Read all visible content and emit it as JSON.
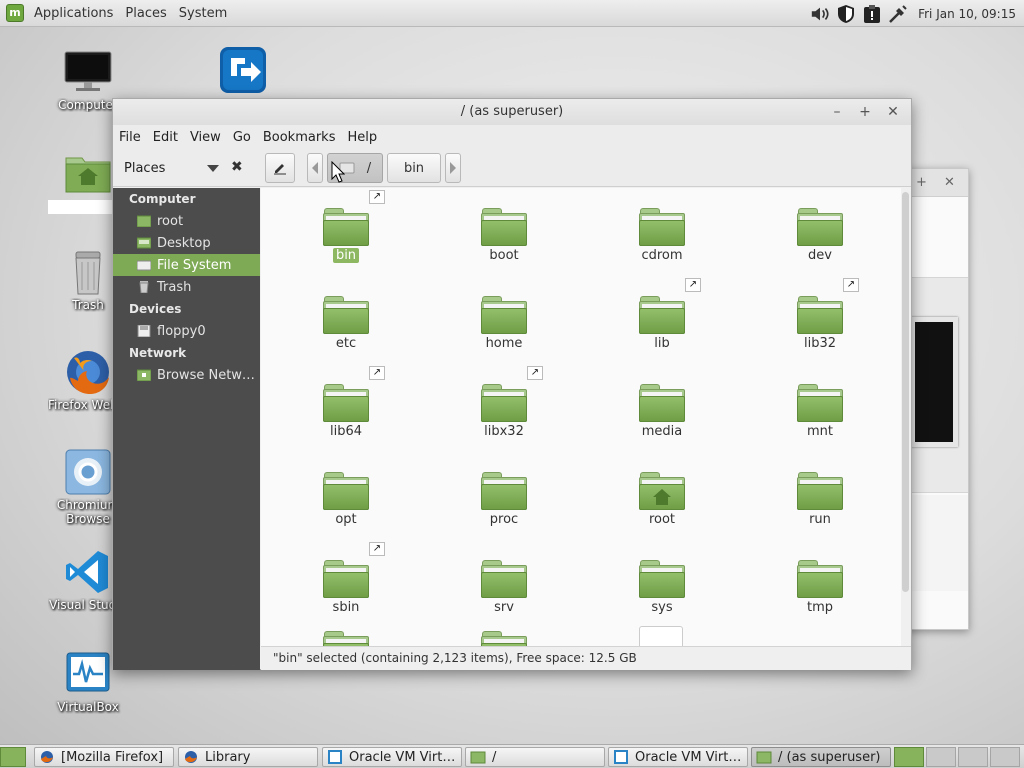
{
  "top_panel": {
    "menus": [
      "Applications",
      "Places",
      "System"
    ],
    "clock": "Fri Jan 10, 09:15",
    "tray_icons": [
      "volume-icon",
      "shield-icon",
      "clipboard-alert-icon",
      "network-icon"
    ]
  },
  "desktop": {
    "icons": [
      {
        "label": "Computer",
        "icon": "monitor-icon"
      },
      {
        "label": "",
        "icon": "blue-arrow-app-icon"
      },
      {
        "label": "",
        "icon": "home-folder-icon"
      },
      {
        "label": "Trash",
        "icon": "trash-icon"
      },
      {
        "label": "Firefox Web B",
        "icon": "firefox-icon"
      },
      {
        "label": "Chromium",
        "label2": "Browse",
        "icon": "chromium-icon"
      },
      {
        "label": "Visual Studio",
        "icon": "vscode-icon"
      },
      {
        "label": "VirtualBox",
        "icon": "virtualbox-icon"
      }
    ]
  },
  "window": {
    "title": "/ (as superuser)",
    "menus": [
      "File",
      "Edit",
      "View",
      "Go",
      "Bookmarks",
      "Help"
    ],
    "places_label": "Places",
    "breadcrumbs": [
      "/",
      "bin"
    ]
  },
  "sidebar": {
    "sections": [
      {
        "heading": "Computer",
        "items": [
          "root",
          "Desktop",
          "File System",
          "Trash"
        ]
      },
      {
        "heading": "Devices",
        "items": [
          "floppy0"
        ]
      },
      {
        "heading": "Network",
        "items": [
          "Browse Netw…"
        ]
      }
    ],
    "selected": "File System"
  },
  "files": [
    {
      "name": "bin",
      "link": true,
      "selected": true
    },
    {
      "name": "boot",
      "link": false
    },
    {
      "name": "cdrom",
      "link": false
    },
    {
      "name": "dev",
      "link": false
    },
    {
      "name": "etc",
      "link": false
    },
    {
      "name": "home",
      "link": false
    },
    {
      "name": "lib",
      "link": true
    },
    {
      "name": "lib32",
      "link": true
    },
    {
      "name": "lib64",
      "link": true
    },
    {
      "name": "libx32",
      "link": true
    },
    {
      "name": "media",
      "link": false
    },
    {
      "name": "mnt",
      "link": false
    },
    {
      "name": "opt",
      "link": false
    },
    {
      "name": "proc",
      "link": false
    },
    {
      "name": "root",
      "link": false,
      "home": true
    },
    {
      "name": "run",
      "link": false
    },
    {
      "name": "sbin",
      "link": true
    },
    {
      "name": "srv",
      "link": false
    },
    {
      "name": "sys",
      "link": false
    },
    {
      "name": "tmp",
      "link": false
    }
  ],
  "status": "\"bin\" selected (containing 2,123 items), Free space: 12.5 GB",
  "taskbar": {
    "items": [
      {
        "label": "[Mozilla Firefox]",
        "icon": "firefox-icon"
      },
      {
        "label": "Library",
        "icon": "firefox-icon"
      },
      {
        "label": "Oracle VM Virt…",
        "icon": "virtualbox-icon"
      },
      {
        "label": "/",
        "icon": "folder-icon"
      },
      {
        "label": "Oracle VM Virt…",
        "icon": "virtualbox-icon"
      },
      {
        "label": "/ (as superuser)",
        "icon": "folder-icon",
        "active": true
      }
    ]
  },
  "colors": {
    "accent": "#7faa55",
    "folder": "#8cb764",
    "sidebar": "#4c4c4c"
  }
}
